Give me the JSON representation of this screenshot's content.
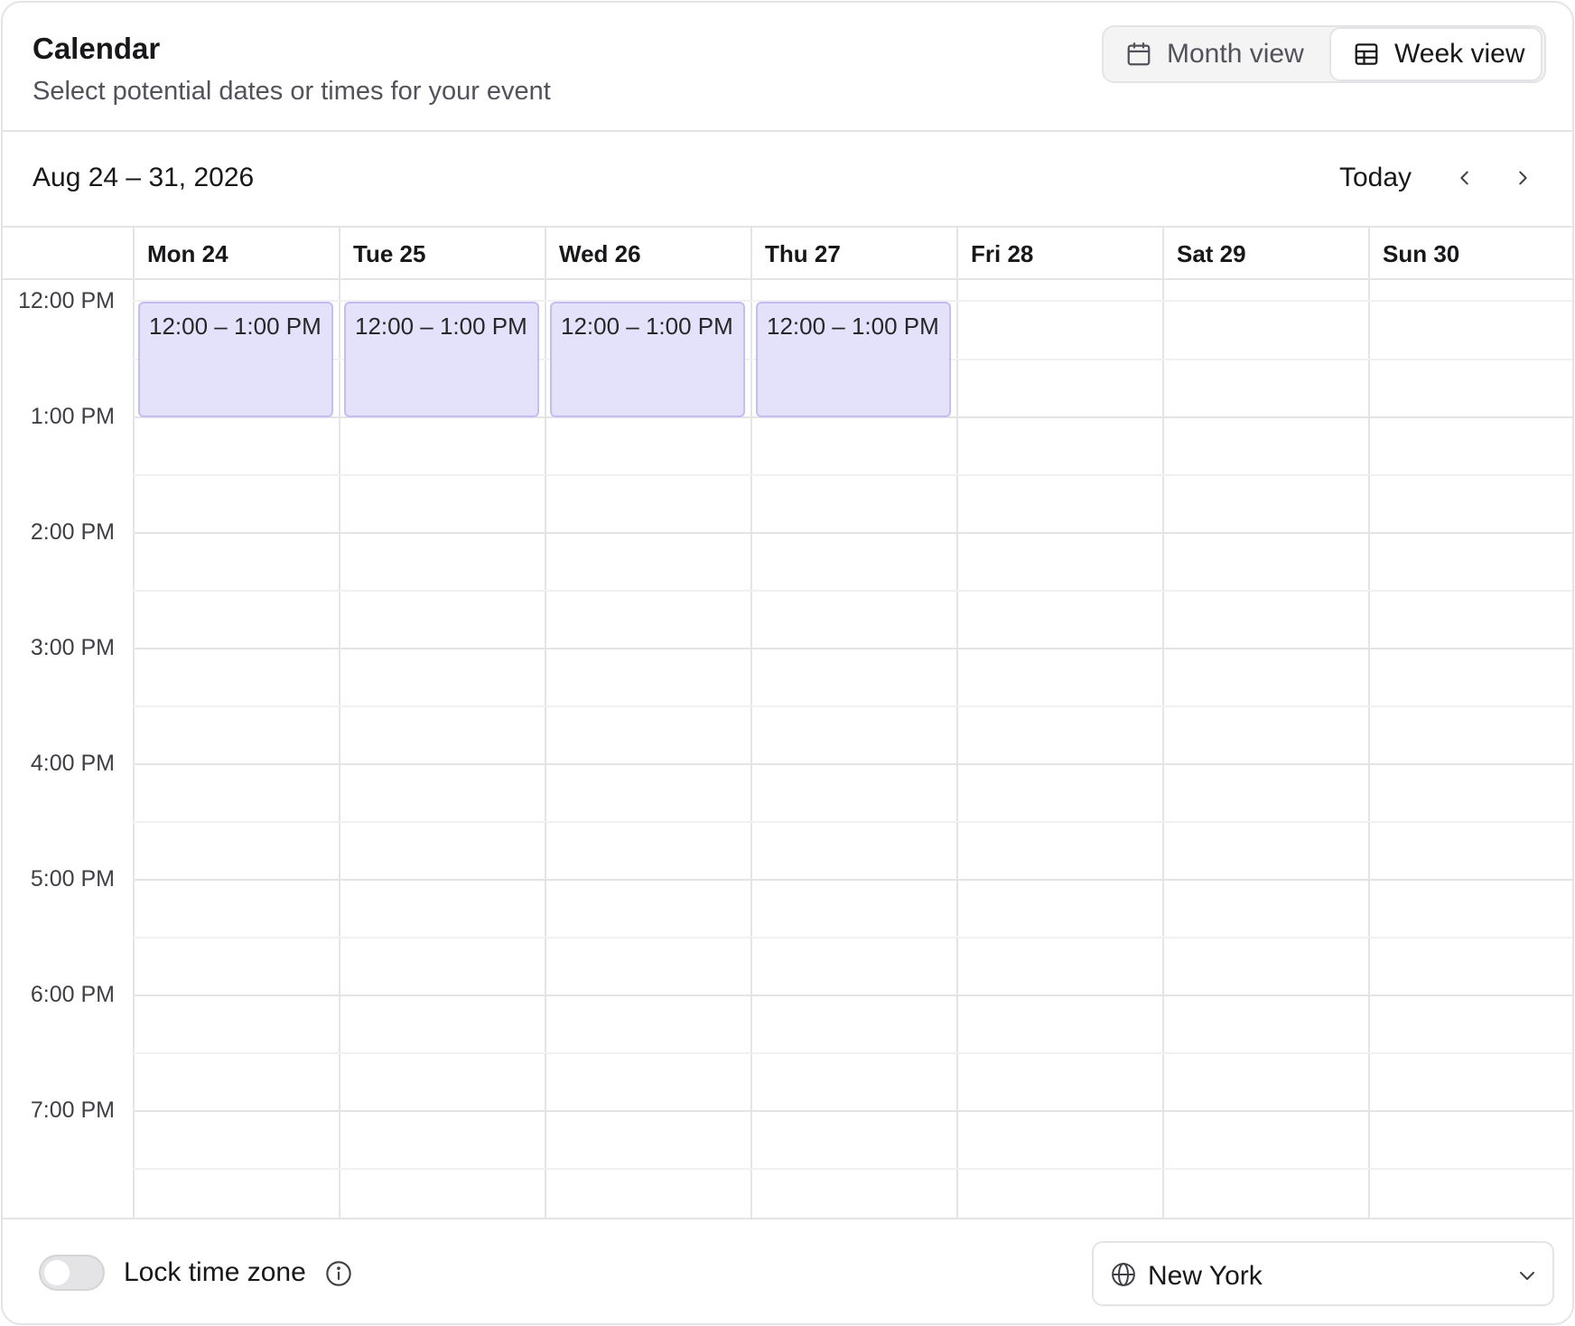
{
  "header": {
    "title": "Calendar",
    "subtitle": "Select potential dates or times for your event",
    "views": {
      "month_label": "Month view",
      "week_label": "Week view",
      "active": "week"
    }
  },
  "range": {
    "label": "Aug 24 – 31, 2026",
    "today_label": "Today"
  },
  "days": [
    "Mon 24",
    "Tue 25",
    "Wed 26",
    "Thu 27",
    "Fri 28",
    "Sat 29",
    "Sun 30"
  ],
  "times": [
    "12:00 PM",
    "1:00 PM",
    "2:00 PM",
    "3:00 PM",
    "4:00 PM",
    "5:00 PM",
    "6:00 PM",
    "7:00 PM"
  ],
  "events": [
    {
      "day": 0,
      "label": "12:00 – 1:00 PM",
      "start_hour": 0,
      "duration_hours": 1
    },
    {
      "day": 1,
      "label": "12:00 – 1:00 PM",
      "start_hour": 0,
      "duration_hours": 1
    },
    {
      "day": 2,
      "label": "12:00 – 1:00 PM",
      "start_hour": 0,
      "duration_hours": 1
    },
    {
      "day": 3,
      "label": "12:00 – 1:00 PM",
      "start_hour": 0,
      "duration_hours": 1
    }
  ],
  "footer": {
    "lock_label": "Lock time zone",
    "lock_enabled": false,
    "timezone": "New York"
  },
  "colors": {
    "event_fill": "#e4e1fa",
    "event_border": "#c4bdf2",
    "border": "#e4e4e7"
  }
}
